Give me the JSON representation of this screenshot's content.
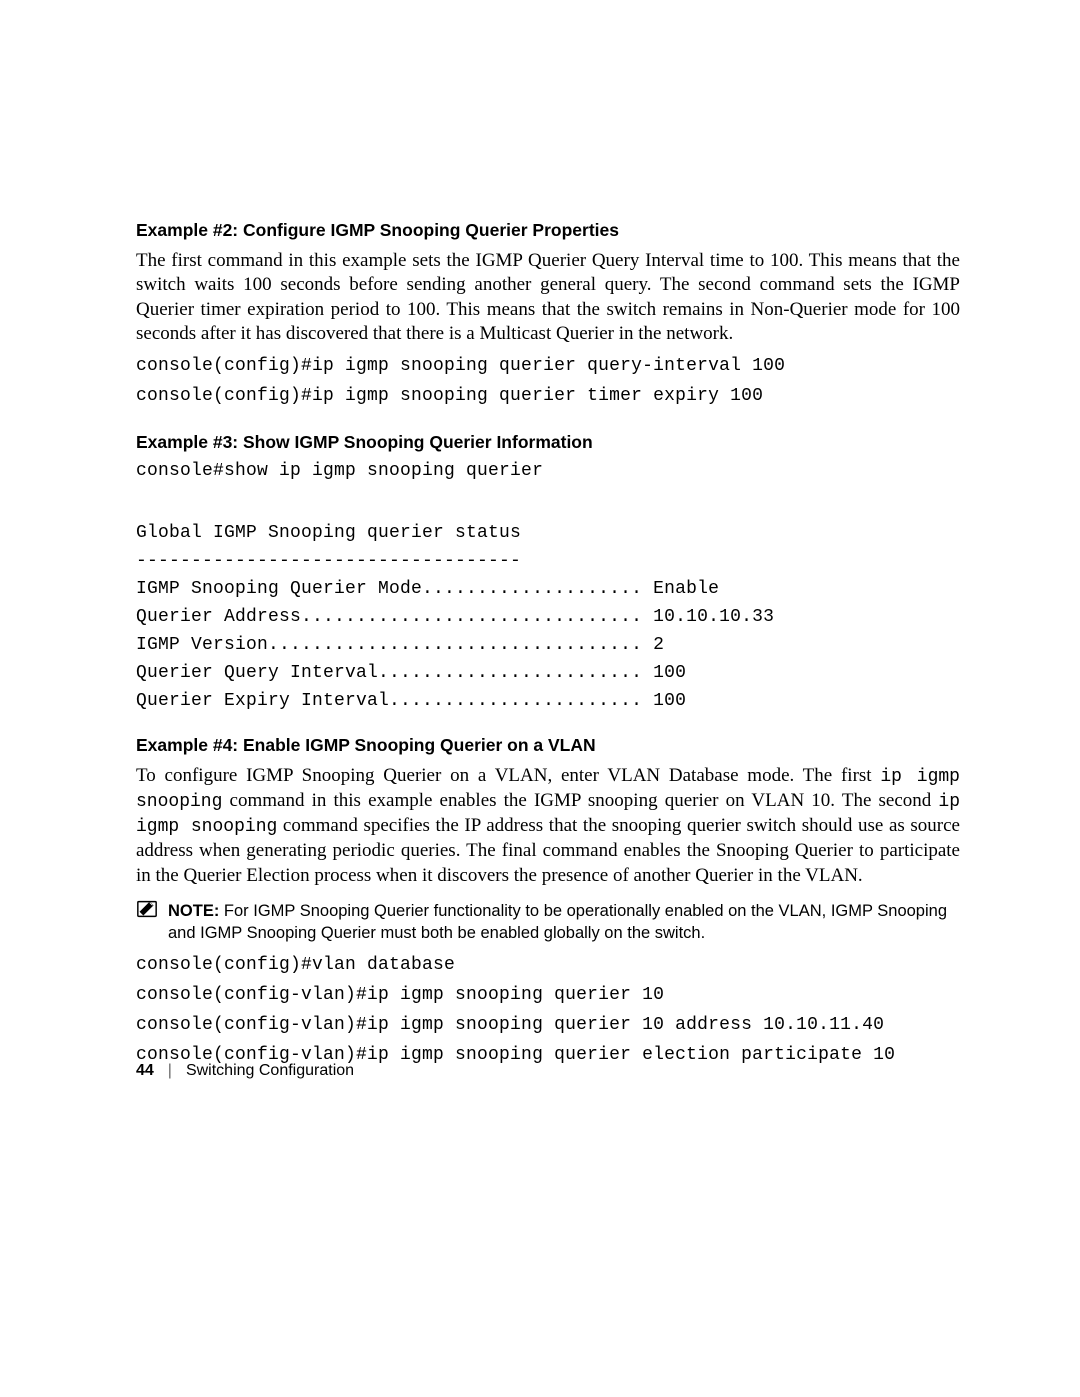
{
  "example2": {
    "heading": "Example #2: Configure IGMP Snooping Querier Properties",
    "para": "The first command in this example sets the IGMP Querier Query Interval time to 100. This means that the switch waits 100 seconds before sending another general query. The second command sets the IGMP Querier timer expiration period to 100. This means that the switch remains in Non-Querier mode for 100 seconds after it has discovered that there is a Multicast Querier in the network.",
    "cmd1": "console(config)#ip igmp snooping querier query-interval 100",
    "cmd2": "console(config)#ip igmp snooping querier timer expiry 100"
  },
  "example3": {
    "heading": "Example #3: Show IGMP Snooping Querier Information",
    "cmd1": "console#show ip igmp snooping querier",
    "line1": "Global IGMP Snooping querier status",
    "line2": "-----------------------------------",
    "line3": "IGMP Snooping Querier Mode.................... Enable",
    "line4": "Querier Address............................... 10.10.10.33",
    "line5": "IGMP Version.................................. 2",
    "line6": "Querier Query Interval........................ 100",
    "line7": "Querier Expiry Interval....................... 100"
  },
  "example4": {
    "heading": "Example #4: Enable IGMP Snooping Querier on a VLAN",
    "para_parts": {
      "t1": "To configure IGMP Snooping Querier on a VLAN, enter VLAN Database mode. The first ",
      "m1": "ip igmp snooping",
      "t2": " command in this example enables the IGMP snooping querier on VLAN 10. The second ",
      "m2": "ip igmp snooping",
      "t3": " command specifies the IP address that the snooping querier switch should use as source address when generating periodic queries. The final command enables the Snooping Querier to participate in the Querier Election process when it discovers the presence of another Querier in the VLAN."
    },
    "note_label": "NOTE:",
    "note_text": " For IGMP Snooping Querier functionality to be operationally enabled on the VLAN, IGMP Snooping and IGMP Snooping Querier must both be enabled globally on the switch.",
    "cmd1": "console(config)#vlan database",
    "cmd2": "console(config-vlan)#ip igmp snooping querier 10",
    "cmd3": "console(config-vlan)#ip igmp snooping querier 10 address 10.10.11.40",
    "cmd4": "console(config-vlan)#ip igmp snooping querier election participate 10"
  },
  "footer": {
    "page_number": "44",
    "separator": "|",
    "section": "Switching Configuration"
  }
}
